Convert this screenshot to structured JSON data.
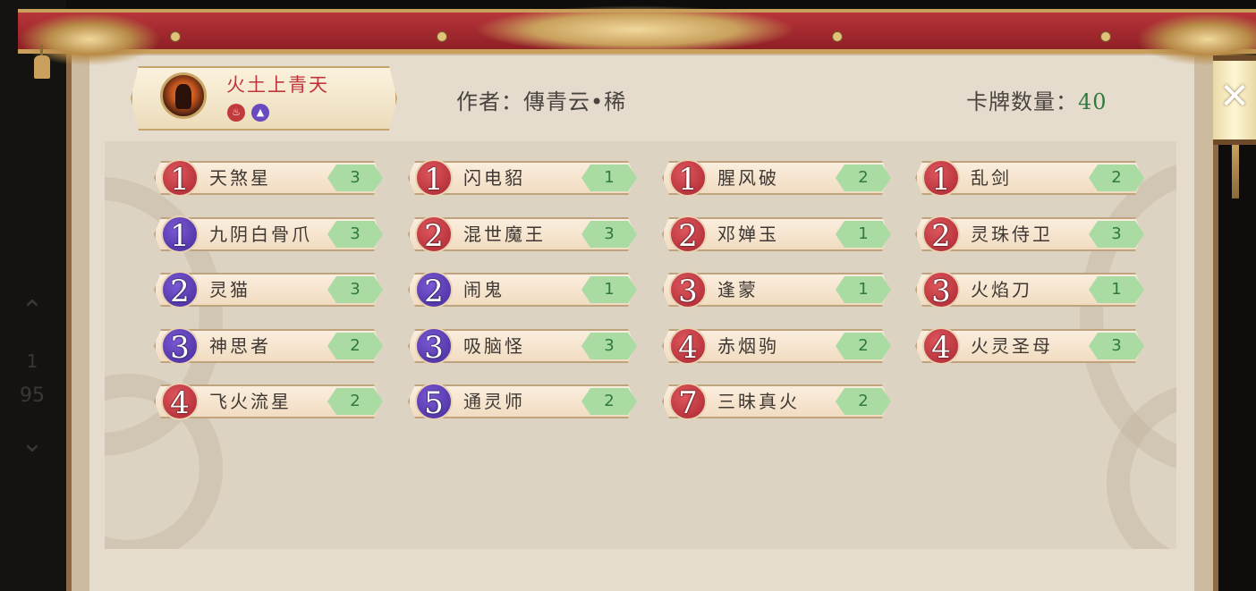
{
  "deck": {
    "name": "火土上青天",
    "elements": [
      "fire-icon",
      "earth-icon"
    ]
  },
  "author": {
    "label": "作者：",
    "name": "傳青云•稀"
  },
  "card_count": {
    "label": "卡牌数量：",
    "value": "40"
  },
  "close_label": "✕",
  "sidebar": {
    "up": "⌃",
    "page": "1",
    "total": "95",
    "down": "⌄"
  },
  "colors": {
    "fire": "#b32b34",
    "water": "#5a37b8",
    "quantity_bg": "#a9dba3",
    "quantity_text": "#2f7a3e",
    "deck_name": "#c0353c",
    "banner": "#a32a30"
  },
  "cards": [
    {
      "cost": "1",
      "name": "天煞星",
      "qty": "3",
      "color": "red"
    },
    {
      "cost": "1",
      "name": "闪电貂",
      "qty": "1",
      "color": "red"
    },
    {
      "cost": "1",
      "name": "腥风破",
      "qty": "2",
      "color": "red"
    },
    {
      "cost": "1",
      "name": "乱剑",
      "qty": "2",
      "color": "red"
    },
    {
      "cost": "1",
      "name": "九阴白骨爪",
      "qty": "3",
      "color": "purple"
    },
    {
      "cost": "2",
      "name": "混世魔王",
      "qty": "3",
      "color": "red"
    },
    {
      "cost": "2",
      "name": "邓婵玉",
      "qty": "1",
      "color": "red"
    },
    {
      "cost": "2",
      "name": "灵珠侍卫",
      "qty": "3",
      "color": "red"
    },
    {
      "cost": "2",
      "name": "灵猫",
      "qty": "3",
      "color": "purple"
    },
    {
      "cost": "2",
      "name": "闹鬼",
      "qty": "1",
      "color": "purple"
    },
    {
      "cost": "3",
      "name": "逢蒙",
      "qty": "1",
      "color": "red"
    },
    {
      "cost": "3",
      "name": "火焰刀",
      "qty": "1",
      "color": "red"
    },
    {
      "cost": "3",
      "name": "神思者",
      "qty": "2",
      "color": "purple"
    },
    {
      "cost": "3",
      "name": "吸脑怪",
      "qty": "3",
      "color": "purple"
    },
    {
      "cost": "4",
      "name": "赤烟驹",
      "qty": "2",
      "color": "red"
    },
    {
      "cost": "4",
      "name": "火灵圣母",
      "qty": "3",
      "color": "red"
    },
    {
      "cost": "4",
      "name": "飞火流星",
      "qty": "2",
      "color": "red"
    },
    {
      "cost": "5",
      "name": "通灵师",
      "qty": "2",
      "color": "purple"
    },
    {
      "cost": "7",
      "name": "三昧真火",
      "qty": "2",
      "color": "red"
    }
  ]
}
